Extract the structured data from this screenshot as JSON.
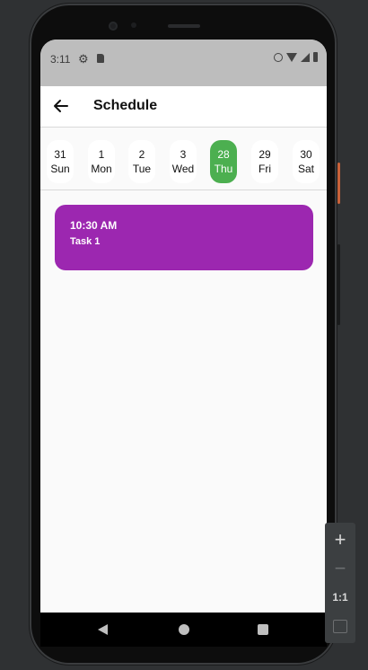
{
  "status_bar": {
    "time": "3:11",
    "icons": [
      "gear-icon",
      "sd-card-icon",
      "alarm-icon",
      "wifi-icon",
      "signal-icon",
      "battery-icon"
    ]
  },
  "app_bar": {
    "title": "Schedule",
    "back_icon": "arrow-left-icon"
  },
  "date_strip": {
    "days": [
      {
        "num": "31",
        "name": "Sun",
        "selected": false
      },
      {
        "num": "1",
        "name": "Mon",
        "selected": false
      },
      {
        "num": "2",
        "name": "Tue",
        "selected": false
      },
      {
        "num": "3",
        "name": "Wed",
        "selected": false
      },
      {
        "num": "28",
        "name": "Thu",
        "selected": true
      },
      {
        "num": "29",
        "name": "Fri",
        "selected": false
      },
      {
        "num": "30",
        "name": "Sat",
        "selected": false
      }
    ]
  },
  "events": [
    {
      "time": "10:30 AM",
      "title": "Task 1"
    }
  ],
  "emulator_panel": {
    "zoom_in": "+",
    "zoom_out": "−",
    "ratio": "1:1"
  },
  "colors": {
    "selected_day": "#4caf50",
    "event": "#9c27b0",
    "status_bar": "#bdbdbd"
  }
}
